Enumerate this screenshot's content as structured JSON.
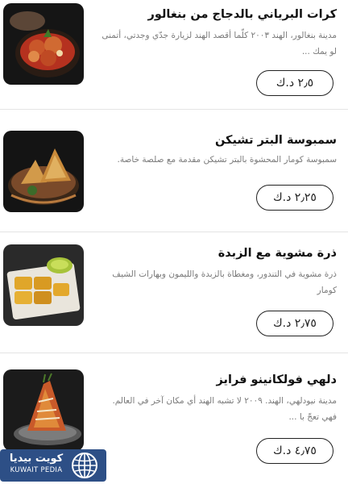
{
  "menu": {
    "items": [
      {
        "title": "كرات البرياني بالدجاج من بنغالور",
        "description": "مدينة بنغالور، الهند ٢٠٠٣ كلّما أقصد الهند لزيارة جدّي وجدتي، أتمنى لو يمك ...",
        "price": "٢٫٥ د.ك",
        "image_icon": "biryani-balls-photo"
      },
      {
        "title": "سمبوسة البتر تشيكن",
        "description": "سمبوسة كومار المحشوة بالبتر تشيكن مقدمة مع صلصة خاصة.",
        "price": "٢٫٢٥ د.ك",
        "image_icon": "samosa-photo"
      },
      {
        "title": "ذرة مشوية مع الزبدة",
        "description": "ذرة مشوية في التندور، ومغطاة بالزبدة والليمون وبهارات الشيف كومار",
        "price": "٢٫٧٥ د.ك",
        "image_icon": "grilled-corn-photo"
      },
      {
        "title": "دلهي فولكانينو فرايز",
        "description": "مدينة نيودلهي، الهند. ٢٠٠٩ لا تشبه الهند أي مكان آخر في العالم. فهي تعجّ با ...",
        "price": "٤٫٧٥ د.ك",
        "image_icon": "volcano-fries-photo"
      }
    ]
  },
  "watermark": {
    "arabic": "كويت بيديا",
    "english": "KUWAIT PEDIA",
    "icon": "globe-icon"
  }
}
